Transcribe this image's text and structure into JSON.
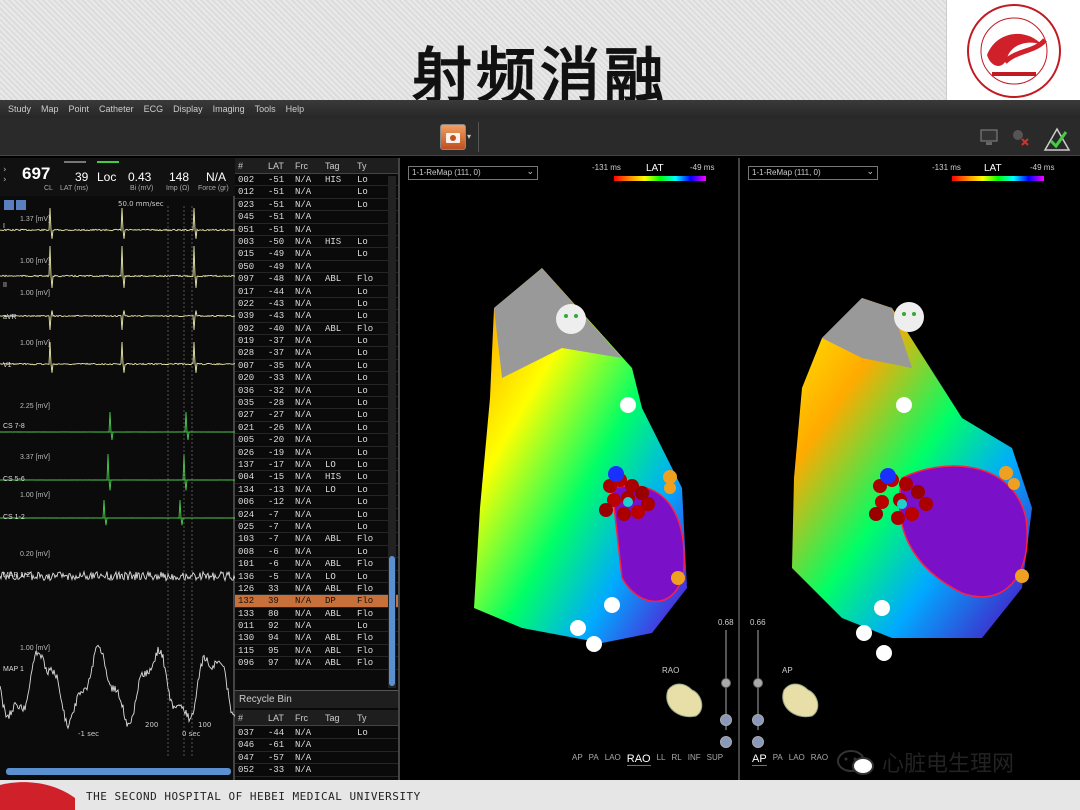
{
  "slide": {
    "title": "射频消融",
    "footer_text": "THE SECOND HOSPITAL OF HEBEI MEDICAL UNIVERSITY",
    "wechat_label": "心脏电生理网",
    "logo_ring_text": "THE SECOND HOSPITAL OF HEBEI MEDICAL"
  },
  "app": {
    "menu": [
      "Study",
      "Map",
      "Point",
      "Catheter",
      "ECG",
      "Display",
      "Imaging",
      "Tools",
      "Help"
    ]
  },
  "ecg_header": {
    "cl_value": "697",
    "cl_label": "CL",
    "lat_value": "39",
    "lat_label": "LAT (ms)",
    "loc_label": "Loc",
    "bi_value": "0.43",
    "bi_label": "Bi (mV)",
    "imp_value": "148",
    "imp_label": "Imp (Ω)",
    "force_value": "N/A",
    "force_label": "Force (gr)",
    "sweep": "50.0 mm/sec"
  },
  "ecg_channels": [
    {
      "label": "I",
      "gain": "1.37 [mV]"
    },
    {
      "label": "II",
      "gain": "1.00 [mV]"
    },
    {
      "label": "aVR",
      "gain": "1.00 [mV]"
    },
    {
      "label": "V1",
      "gain": "1.00 [mV]"
    },
    {
      "label": "CS 7-8",
      "gain": "2.25 [mV]"
    },
    {
      "label": "CS 5-6",
      "gain": "3.37 [mV]"
    },
    {
      "label": "CS 1-2",
      "gain": "1.00 [mV]"
    },
    {
      "label": "MAP 1-2",
      "gain": "0.20 [mV]"
    },
    {
      "label": "MAP 1",
      "gain": "1.00 [mV]"
    }
  ],
  "ecg_footer": {
    "left": "-1 sec",
    "mid": "200",
    "right": "0 sec",
    "far": "100"
  },
  "table": {
    "columns": [
      "#",
      "LAT",
      "Frc",
      "Tag",
      "Ty"
    ],
    "rows": [
      [
        "002",
        "-51",
        "N/A",
        "HIS",
        "Lo"
      ],
      [
        "012",
        "-51",
        "N/A",
        "",
        "Lo"
      ],
      [
        "023",
        "-51",
        "N/A",
        "",
        "Lo"
      ],
      [
        "045",
        "-51",
        "N/A",
        "",
        ""
      ],
      [
        "051",
        "-51",
        "N/A",
        "",
        ""
      ],
      [
        "003",
        "-50",
        "N/A",
        "HIS",
        "Lo"
      ],
      [
        "015",
        "-49",
        "N/A",
        "",
        "Lo"
      ],
      [
        "050",
        "-49",
        "N/A",
        "",
        ""
      ],
      [
        "097",
        "-48",
        "N/A",
        "ABL",
        "Flo"
      ],
      [
        "017",
        "-44",
        "N/A",
        "",
        "Lo"
      ],
      [
        "022",
        "-43",
        "N/A",
        "",
        "Lo"
      ],
      [
        "039",
        "-43",
        "N/A",
        "",
        "Lo"
      ],
      [
        "092",
        "-40",
        "N/A",
        "ABL",
        "Flo"
      ],
      [
        "019",
        "-37",
        "N/A",
        "",
        "Lo"
      ],
      [
        "028",
        "-37",
        "N/A",
        "",
        "Lo"
      ],
      [
        "007",
        "-35",
        "N/A",
        "",
        "Lo"
      ],
      [
        "020",
        "-33",
        "N/A",
        "",
        "Lo"
      ],
      [
        "036",
        "-32",
        "N/A",
        "",
        "Lo"
      ],
      [
        "035",
        "-28",
        "N/A",
        "",
        "Lo"
      ],
      [
        "027",
        "-27",
        "N/A",
        "",
        "Lo"
      ],
      [
        "021",
        "-26",
        "N/A",
        "",
        "Lo"
      ],
      [
        "005",
        "-20",
        "N/A",
        "",
        "Lo"
      ],
      [
        "026",
        "-19",
        "N/A",
        "",
        "Lo"
      ],
      [
        "137",
        "-17",
        "N/A",
        "LO",
        "Lo"
      ],
      [
        "004",
        "-15",
        "N/A",
        "HIS",
        "Lo"
      ],
      [
        "134",
        "-13",
        "N/A",
        "LO",
        "Lo"
      ],
      [
        "006",
        "-12",
        "N/A",
        "",
        "Lo"
      ],
      [
        "024",
        "-7",
        "N/A",
        "",
        "Lo"
      ],
      [
        "025",
        "-7",
        "N/A",
        "",
        "Lo"
      ],
      [
        "103",
        "-7",
        "N/A",
        "ABL",
        "Flo"
      ],
      [
        "008",
        "-6",
        "N/A",
        "",
        "Lo"
      ],
      [
        "101",
        "-6",
        "N/A",
        "ABL",
        "Flo"
      ],
      [
        "136",
        "-5",
        "N/A",
        "LO",
        "Lo"
      ],
      [
        "126",
        "33",
        "N/A",
        "ABL",
        "Flo"
      ],
      [
        "132",
        "39",
        "N/A",
        "DP",
        "Flo"
      ],
      [
        "133",
        "80",
        "N/A",
        "ABL",
        "Flo"
      ],
      [
        "011",
        "92",
        "N/A",
        "",
        "Lo"
      ],
      [
        "130",
        "94",
        "N/A",
        "ABL",
        "Flo"
      ],
      [
        "115",
        "95",
        "N/A",
        "ABL",
        "Flo"
      ],
      [
        "096",
        "97",
        "N/A",
        "ABL",
        "Flo"
      ]
    ],
    "selected_index": 34,
    "recycle_title": "Recycle Bin",
    "recycle_rows": [
      [
        "037",
        "-44",
        "N/A",
        "",
        "Lo"
      ],
      [
        "046",
        "-61",
        "N/A",
        "",
        ""
      ],
      [
        "047",
        "-57",
        "N/A",
        "",
        ""
      ],
      [
        "052",
        "-33",
        "N/A",
        "",
        ""
      ]
    ]
  },
  "maps": [
    {
      "select": "1-1-ReMap (111, 0)",
      "lat_min": "-131 ms",
      "lat_label": "LAT",
      "lat_max": "-49 ms",
      "slider_value": "0.68",
      "view_label": "RAO",
      "orientations": [
        "AP",
        "PA",
        "LAO",
        "RAO",
        "LL",
        "RL",
        "INF",
        "SUP"
      ],
      "active": "RAO"
    },
    {
      "select": "1-1-ReMap (111, 0)",
      "lat_min": "-131 ms",
      "lat_label": "LAT",
      "lat_max": "-49 ms",
      "slider_value": "0.66",
      "view_label": "AP",
      "orientations": [
        "AP",
        "PA",
        "LAO",
        "RAO"
      ],
      "active": "AP"
    }
  ],
  "colors": {
    "accent": "#c8703a",
    "lat_scale": [
      "#ff0000",
      "#ffff00",
      "#00ff00",
      "#00ffff",
      "#0000ff",
      "#ff00ff"
    ],
    "brand_red": "#d0202a"
  }
}
